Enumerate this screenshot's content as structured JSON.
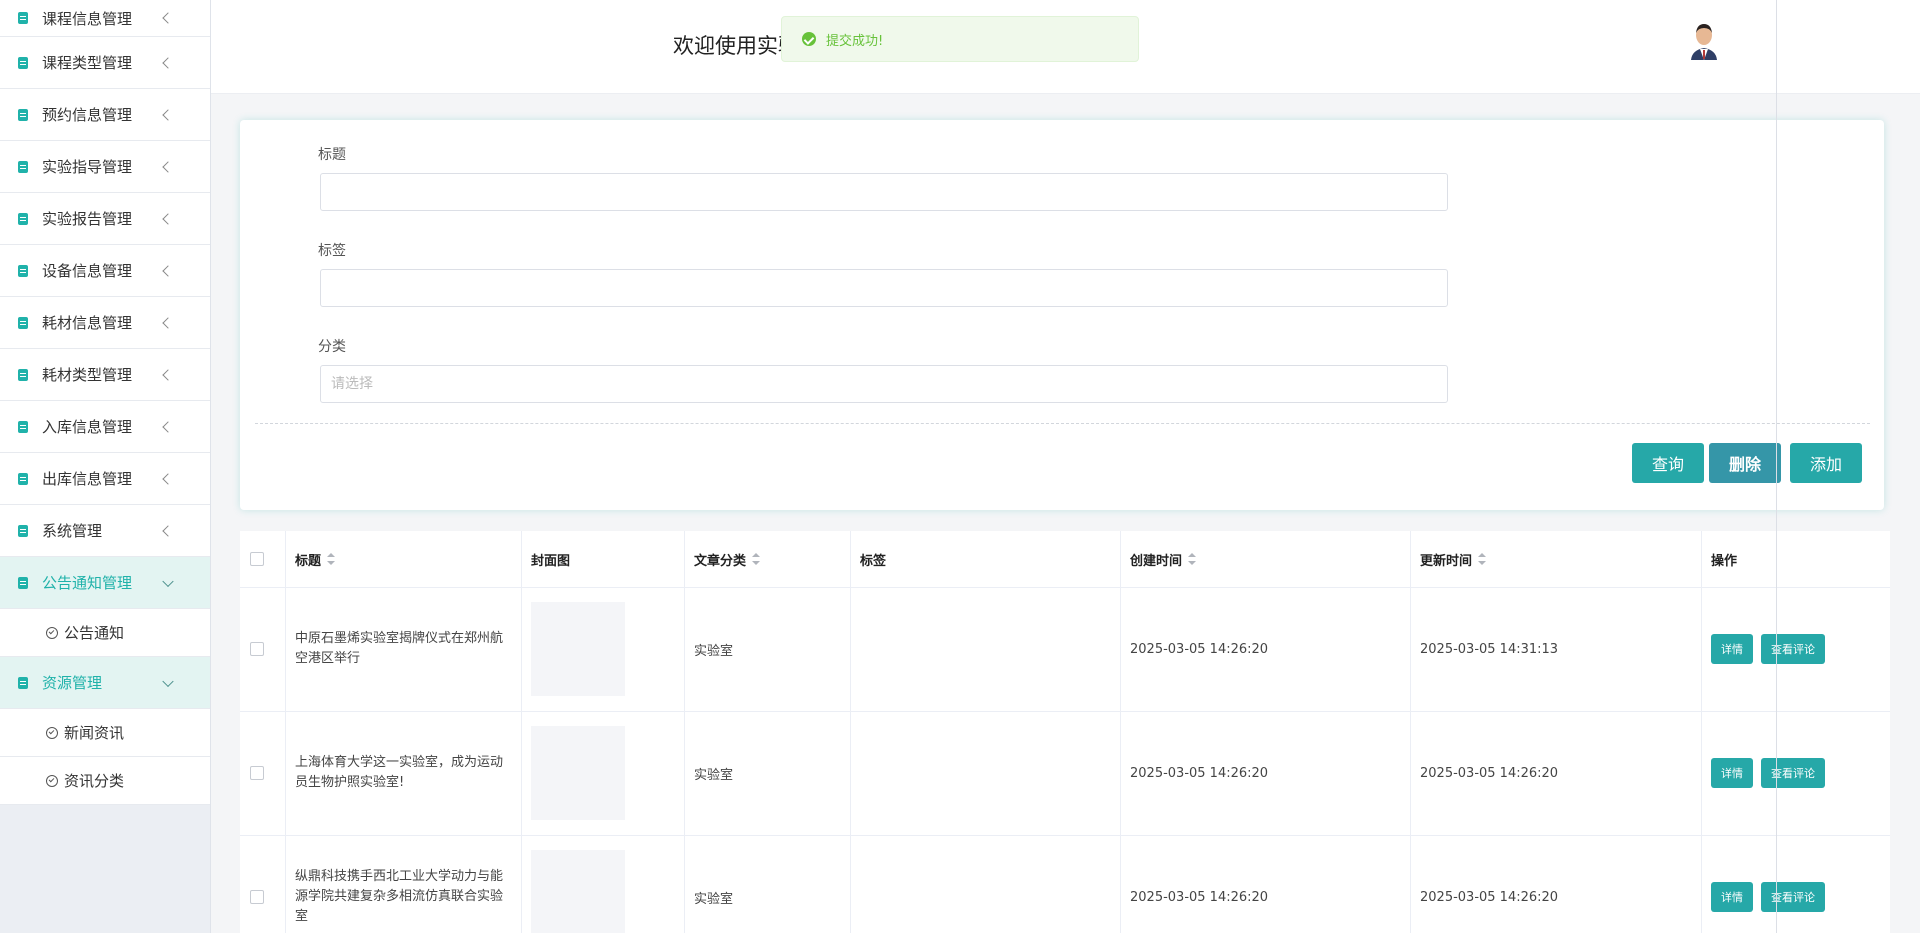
{
  "sidebar": {
    "items": [
      {
        "label": "课程信息管理"
      },
      {
        "label": "课程类型管理"
      },
      {
        "label": "预约信息管理"
      },
      {
        "label": "实验指导管理"
      },
      {
        "label": "实验报告管理"
      },
      {
        "label": "设备信息管理"
      },
      {
        "label": "耗材信息管理"
      },
      {
        "label": "耗材类型管理"
      },
      {
        "label": "入库信息管理"
      },
      {
        "label": "出库信息管理"
      },
      {
        "label": "系统管理"
      },
      {
        "label": "公告通知管理",
        "children": [
          {
            "label": "公告通知"
          }
        ]
      },
      {
        "label": "资源管理",
        "children": [
          {
            "label": "新闻资讯"
          },
          {
            "label": "资讯分类"
          }
        ]
      }
    ]
  },
  "header": {
    "welcome": "欢迎使用实验"
  },
  "toast": {
    "message": "提交成功!"
  },
  "form": {
    "title_label": "标题",
    "tag_label": "标签",
    "category_label": "分类",
    "category_placeholder": "请选择",
    "buttons": {
      "query": "查询",
      "delete": "删除",
      "add": "添加"
    }
  },
  "table": {
    "headers": {
      "title": "标题",
      "cover": "封面图",
      "category": "文章分类",
      "tag": "标签",
      "created": "创建时间",
      "updated": "更新时间",
      "actions": "操作"
    },
    "rows": [
      {
        "title": "中原石墨烯实验室揭牌仪式在郑州航空港区举行",
        "category": "实验室",
        "tag": "",
        "created": "2025-03-05 14:26:20",
        "updated": "2025-03-05 14:31:13",
        "detail": "详情",
        "comments": "查看评论"
      },
      {
        "title": "上海体育大学这一实验室，成为运动员生物护照实验室!",
        "category": "实验室",
        "tag": "",
        "created": "2025-03-05 14:26:20",
        "updated": "2025-03-05 14:26:20",
        "detail": "详情",
        "comments": "查看评论"
      },
      {
        "title": "纵鼎科技携手西北工业大学动力与能源学院共建复杂多相流仿真联合实验室",
        "category": "实验室",
        "tag": "",
        "created": "2025-03-05 14:26:20",
        "updated": "2025-03-05 14:26:20",
        "detail": "详情",
        "comments": "查看评论"
      }
    ]
  },
  "colors": {
    "accent": "#26a8a8",
    "success": "#67c23a"
  }
}
